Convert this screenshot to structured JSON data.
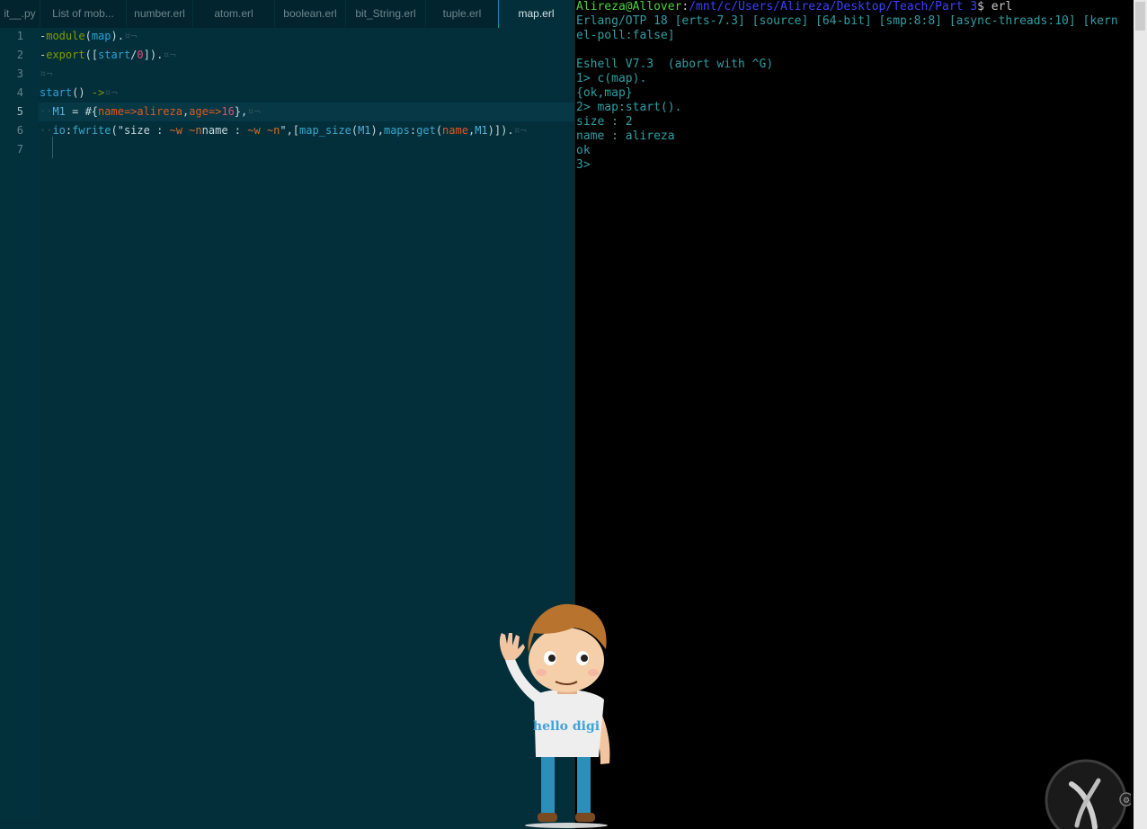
{
  "editor": {
    "tabs": [
      {
        "label": "it__.py",
        "active": false
      },
      {
        "label": "List of mob...",
        "active": false
      },
      {
        "label": "number.erl",
        "active": false
      },
      {
        "label": "atom.erl",
        "active": false
      },
      {
        "label": "boolean.erl",
        "active": false
      },
      {
        "label": "bit_String.erl",
        "active": false
      },
      {
        "label": "tuple.erl",
        "active": false
      },
      {
        "label": "map.erl",
        "active": true
      }
    ],
    "line_numbers": [
      "1",
      "2",
      "3",
      "4",
      "5",
      "6",
      "7"
    ],
    "current_line": "5",
    "code": {
      "l1": {
        "dash": "-",
        "kw": "module",
        "open": "(",
        "name": "map",
        "close": ").",
        "eol": "¤¬"
      },
      "l2": {
        "dash": "-",
        "kw": "export",
        "open": "([",
        "fn": "start",
        "slash": "/",
        "arity": "0",
        "close": "]).",
        "eol": "¤¬"
      },
      "l3": {
        "eol": "¤¬"
      },
      "l4": {
        "fn": "start",
        "parens": "()",
        "arrow": " ->",
        "eol": "¤¬"
      },
      "l5": {
        "indent": "··",
        "var": "M1",
        "eq": " = #{",
        "k1": "name",
        "a1": "=>",
        "v1": "alireza",
        "comma": ",",
        "k2": "age",
        "a2": "=>",
        "v2": "16",
        "close": "},",
        "eol": "¤¬"
      },
      "l6": {
        "indent": "··",
        "mod": "io",
        "colon": ":",
        "fn": "fwrite",
        "open": "(\"size : ",
        "f1": "~w ~n",
        "mid": "name : ",
        "f2": "~w ~n",
        "strclose": "\",[",
        "fn2": "map_size",
        "p1": "(",
        "var1": "M1",
        "p2": "),",
        "mod2": "maps",
        "colon2": ":",
        "fn3": "get",
        "p3": "(",
        "k": "name",
        "comma": ",",
        "var2": "M1",
        "end": ")]).",
        "eol": "¤¬"
      }
    }
  },
  "terminal": {
    "prompt_user": "Alireza@Allover",
    "prompt_sep": ":",
    "prompt_path": "/mnt/c/Users/Alireza/Desktop/Teach/Part 3",
    "prompt_dollar": "$ erl",
    "lines": [
      "Erlang/OTP 18 [erts-7.3] [source] [64-bit] [smp:8:8] [async-threads:10] [kern",
      "el-poll:false]",
      "",
      "Eshell V7.3  (abort with ^G)",
      "1> c(map).",
      "{ok,map}",
      "2> map:start().",
      "size : 2",
      "name : alireza",
      "ok",
      "3> "
    ]
  },
  "mascot": {
    "shirt_text": "hello digi"
  },
  "colors": {
    "editor_bg": "#032f3b",
    "terminal_bg": "#000000",
    "prompt_user": "#4bd341",
    "prompt_path": "#3a41ff",
    "terminal_text": "#2f9fa4"
  }
}
